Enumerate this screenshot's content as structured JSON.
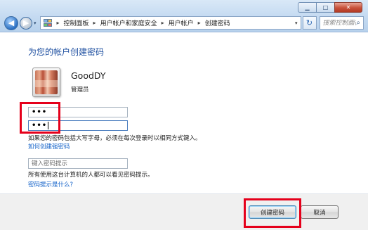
{
  "window": {
    "minimize_glyph": "▁",
    "maximize_glyph": "□",
    "close_glyph": "✕"
  },
  "nav": {
    "back_glyph": "◀",
    "forward_glyph": "▶",
    "history_glyph": "▾",
    "breadcrumb_separator": "▸",
    "breadcrumb": [
      "控制面板",
      "用户帐户和家庭安全",
      "用户帐户",
      "创建密码"
    ],
    "address_dropdown_glyph": "▾",
    "refresh_glyph": "↻",
    "search_placeholder": "搜索控制面板",
    "search_glyph": "⌕"
  },
  "page": {
    "title": "为您的帐户创建密码",
    "user": {
      "name": "GoodDY",
      "role": "管理员"
    },
    "new_password_value": "•••",
    "confirm_password_value": "•••",
    "case_note": "如果您的密码包括大写字母，必须在每次登录时以相同方式键入。",
    "strong_password_link": "如何创建强密码",
    "hint_placeholder": "键入密码提示",
    "hint_note": "所有使用这台计算机的人都可以看见密码提示。",
    "hint_help_link": "密码提示是什么?"
  },
  "buttons": {
    "create": "创建密码",
    "cancel": "取消"
  },
  "colors": {
    "title_blue": "#1e4fa0",
    "link_blue": "#1060c8",
    "highlight_red": "#e5001b"
  }
}
